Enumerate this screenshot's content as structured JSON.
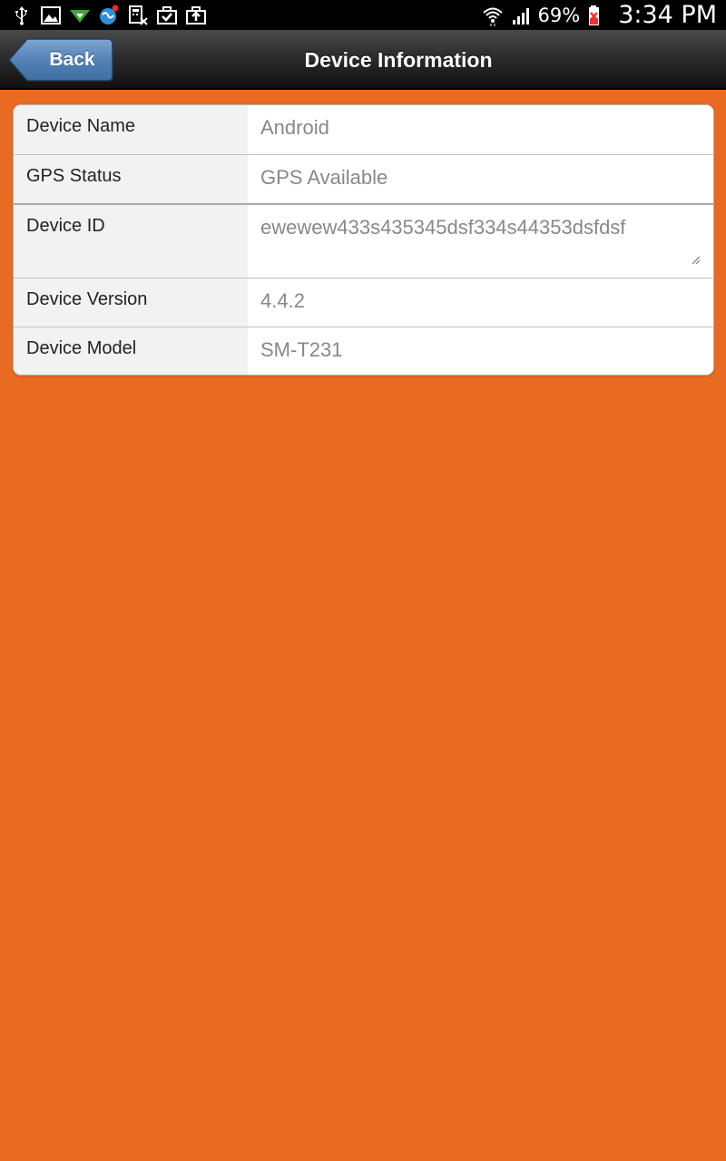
{
  "status_bar": {
    "left_icons": [
      "usb-icon",
      "image-icon",
      "download-icon",
      "globe-notification-icon",
      "calculator-icon",
      "briefcase-check-icon",
      "briefcase-upload-icon"
    ],
    "right_icons": [
      "wifi-icon",
      "signal-icon",
      "battery-icon"
    ],
    "battery_percent": "69%",
    "time": "3:34 PM"
  },
  "header": {
    "title": "Device Information",
    "back_label": "Back"
  },
  "device_info": {
    "rows": [
      {
        "label": "Device Name",
        "value": "Android"
      },
      {
        "label": "GPS Status",
        "value": "GPS Available"
      },
      {
        "label": "Device ID",
        "value": "ewewew433s435345dsf334s44353dsfdsf"
      },
      {
        "label": "Device Version",
        "value": "4.4.2"
      },
      {
        "label": "Device Model",
        "value": "SM-T231"
      }
    ]
  },
  "colors": {
    "background": "#e96a22",
    "header": "#2a2a2a",
    "back_button": "#4f7fb3"
  }
}
